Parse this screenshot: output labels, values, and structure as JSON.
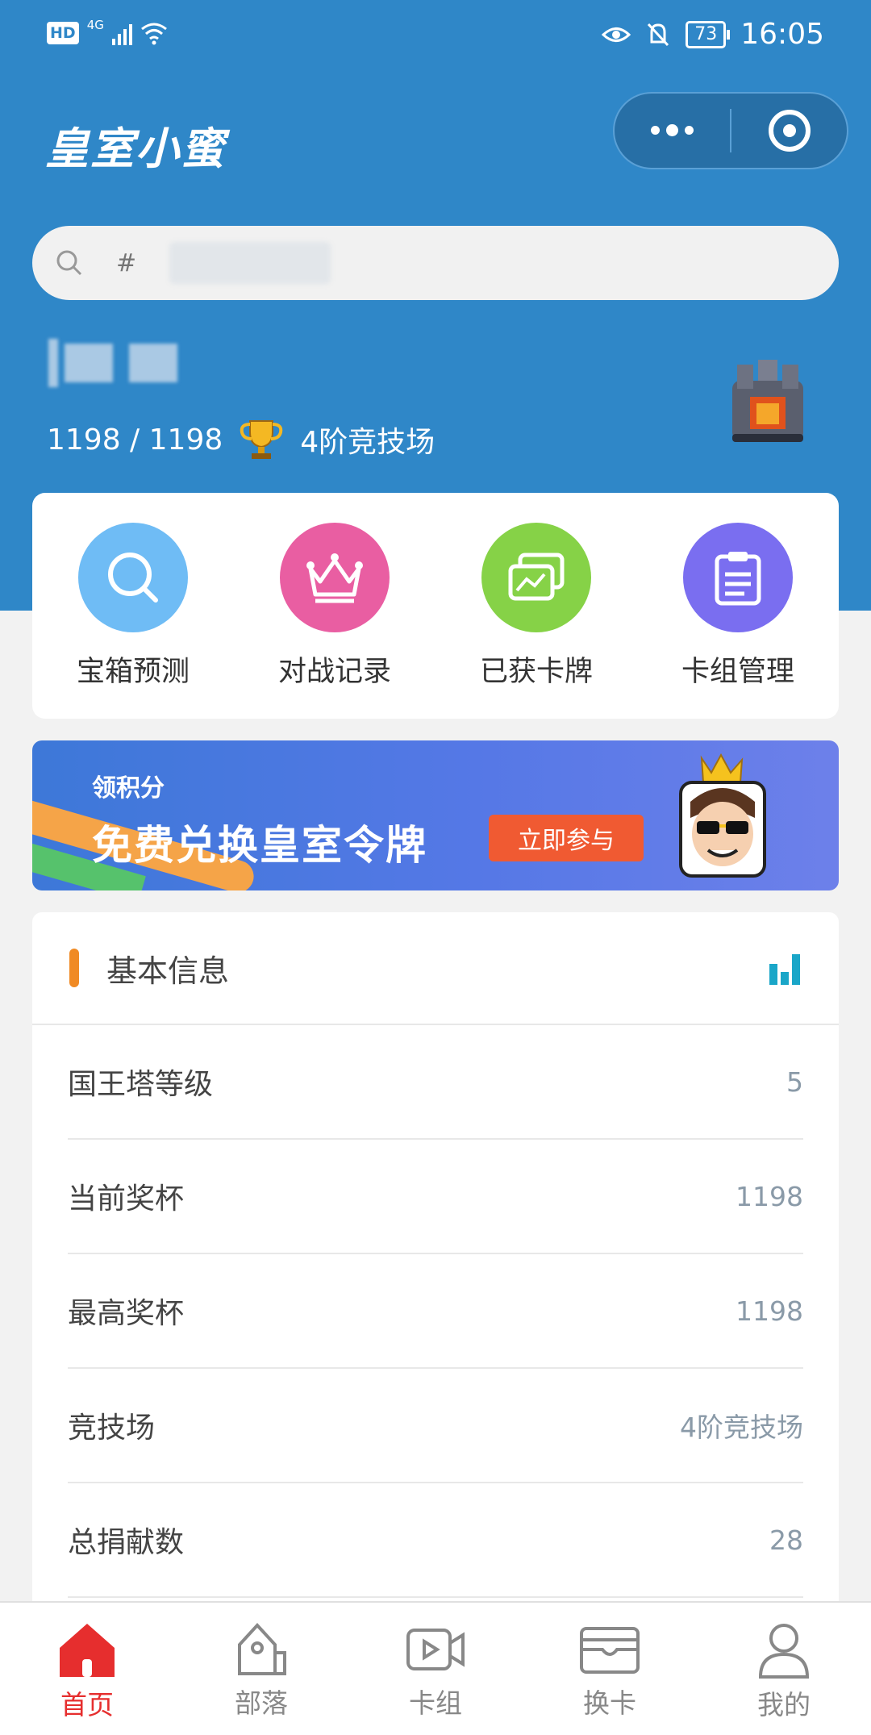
{
  "status_bar": {
    "hd": "HD",
    "signal": "4G",
    "battery": "73",
    "time": "16:05"
  },
  "app": {
    "title": "皇室小蜜"
  },
  "search": {
    "placeholder": "#"
  },
  "player": {
    "trophies": "1198 / 1198",
    "arena": "4阶竞技场"
  },
  "features": [
    {
      "label": "宝箱预测",
      "icon": "search-icon",
      "color": "#6fbcf5"
    },
    {
      "label": "对战记录",
      "icon": "crown-icon",
      "color": "#e95ea2"
    },
    {
      "label": "已获卡牌",
      "icon": "cards-icon",
      "color": "#86d247"
    },
    {
      "label": "卡组管理",
      "icon": "clipboard-icon",
      "color": "#7a6ef0"
    }
  ],
  "banner": {
    "small": "领积分",
    "big": "免费兑换皇室令牌",
    "cta": "立即参与"
  },
  "info": {
    "title": "基本信息",
    "rows": [
      {
        "label": "国王塔等级",
        "value": "5"
      },
      {
        "label": "当前奖杯",
        "value": "1198"
      },
      {
        "label": "最高奖杯",
        "value": "1198"
      },
      {
        "label": "竞技场",
        "value": "4阶竞技场"
      },
      {
        "label": "总捐献数",
        "value": "28"
      }
    ]
  },
  "tabs": [
    {
      "label": "首页",
      "icon": "home-icon",
      "active": true
    },
    {
      "label": "部落",
      "icon": "tag-icon"
    },
    {
      "label": "卡组",
      "icon": "video-icon"
    },
    {
      "label": "换卡",
      "icon": "wallet-icon"
    },
    {
      "label": "我的",
      "icon": "user-icon"
    }
  ],
  "colors": {
    "primary": "#2f87c8",
    "accent": "#f08a24",
    "active_tab": "#e62e2e"
  }
}
